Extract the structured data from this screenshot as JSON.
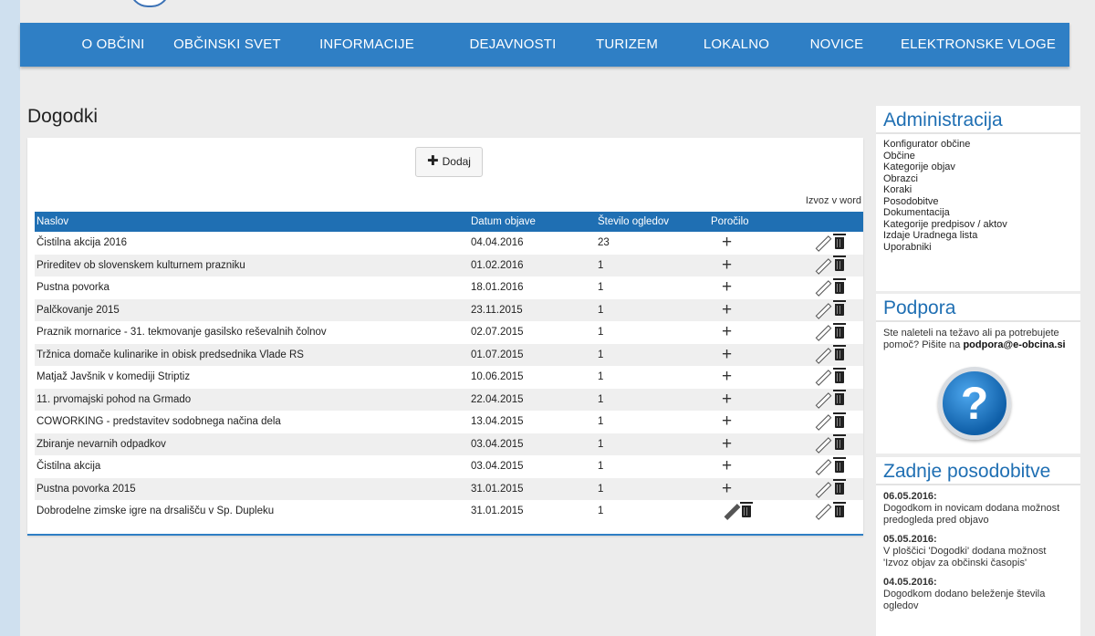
{
  "nav": {
    "items": [
      "O OBČINI",
      "OBČINSKI SVET",
      "INFORMACIJE",
      "DEJAVNOSTI",
      "TURIZEM",
      "LOKALNO",
      "NOVICE",
      "ELEKTRONSKE VLOGE"
    ]
  },
  "page": {
    "title": "Dogodki"
  },
  "toolbar": {
    "add_label": "Dodaj",
    "export_label": "Izvoz v word"
  },
  "table": {
    "headers": [
      "Naslov",
      "Datum objave",
      "Število ogledov",
      "Poročilo"
    ],
    "rows": [
      {
        "title": "Čistilna akcija 2016",
        "date": "04.04.2016",
        "views": "23",
        "report": "add"
      },
      {
        "title": "Prireditev ob slovenskem kulturnem prazniku",
        "date": "01.02.2016",
        "views": "1",
        "report": "add"
      },
      {
        "title": "Pustna povorka",
        "date": "18.01.2016",
        "views": "1",
        "report": "add"
      },
      {
        "title": "Palčkovanje 2015",
        "date": "23.11.2015",
        "views": "1",
        "report": "add"
      },
      {
        "title": "Praznik mornarice - 31. tekmovanje gasilsko reševalnih čolnov",
        "date": "02.07.2015",
        "views": "1",
        "report": "add"
      },
      {
        "title": "Tržnica domače kulinarike in obisk predsednika Vlade RS",
        "date": "01.07.2015",
        "views": "1",
        "report": "add"
      },
      {
        "title": "Matjaž Javšnik v komediji Striptiz",
        "date": "10.06.2015",
        "views": "1",
        "report": "add"
      },
      {
        "title": "11. prvomajski pohod na Grmado",
        "date": "22.04.2015",
        "views": "1",
        "report": "add"
      },
      {
        "title": "COWORKING - predstavitev sodobnega načina dela",
        "date": "13.04.2015",
        "views": "1",
        "report": "add"
      },
      {
        "title": "Zbiranje nevarnih odpadkov",
        "date": "03.04.2015",
        "views": "1",
        "report": "add"
      },
      {
        "title": "Čistilna akcija",
        "date": "03.04.2015",
        "views": "1",
        "report": "add"
      },
      {
        "title": "Pustna povorka 2015",
        "date": "31.01.2015",
        "views": "1",
        "report": "add"
      },
      {
        "title": "Dobrodelne zimske igre na drsališču v Sp. Dupleku",
        "date": "31.01.2015",
        "views": "1",
        "report": "edit"
      }
    ]
  },
  "sidebar": {
    "admin": {
      "title": "Administracija",
      "links": [
        "Konfigurator občine",
        "Občine",
        "Kategorije objav",
        "Obrazci",
        "Koraki",
        "Posodobitve",
        "Dokumentacija",
        "Kategorije predpisov / aktov",
        "Izdaje Uradnega lista",
        "Uporabniki"
      ]
    },
    "support": {
      "title": "Podpora",
      "text": "Ste naleteli na težavo ali pa potrebujete pomoč? Pišite na ",
      "email": "podpora@e-obcina.si"
    },
    "updates": {
      "title": "Zadnje posodobitve",
      "items": [
        {
          "date": "06.05.2016:",
          "text": "Dogodkom in novicam dodana možnost predogleda pred objavo"
        },
        {
          "date": "05.05.2016:",
          "text": "V ploščici 'Dogodki' dodana možnost 'Izvoz objav za občinski časopis'"
        },
        {
          "date": "04.05.2016:",
          "text": "Dogodkom dodano beleženje števila ogledov"
        }
      ]
    }
  },
  "colors": {
    "nav": "#2f7fc5",
    "table_header": "#1f6fb3",
    "background": "#ececec"
  }
}
